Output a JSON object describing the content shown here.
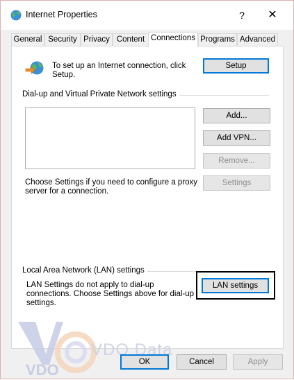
{
  "window": {
    "title": "Internet Properties",
    "help_glyph": "?",
    "close_glyph": "✕"
  },
  "tabs": [
    {
      "label": "General"
    },
    {
      "label": "Security"
    },
    {
      "label": "Privacy"
    },
    {
      "label": "Content"
    },
    {
      "label": "Connections",
      "active": true
    },
    {
      "label": "Programs"
    },
    {
      "label": "Advanced"
    }
  ],
  "setup": {
    "text": "To set up an Internet connection, click Setup.",
    "button": "Setup"
  },
  "dialup": {
    "heading": "Dial-up and Virtual Private Network settings",
    "add_button": "Add...",
    "add_vpn_button": "Add VPN...",
    "remove_button": "Remove...",
    "settings_button": "Settings",
    "hint": "Choose Settings if you need to configure a proxy server for a connection."
  },
  "lan": {
    "heading": "Local Area Network (LAN) settings",
    "text": "LAN Settings do not apply to dial-up connections. Choose Settings above for dial-up settings.",
    "button": "LAN settings"
  },
  "footer": {
    "ok": "OK",
    "cancel": "Cancel",
    "apply": "Apply"
  },
  "watermark": {
    "brand": "VDO Data",
    "logo": "VDO"
  }
}
